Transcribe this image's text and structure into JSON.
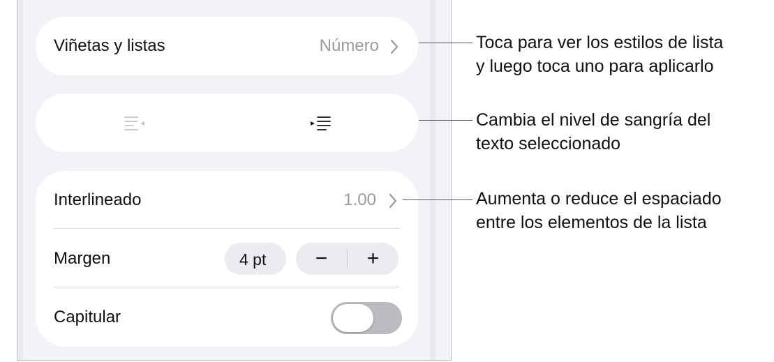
{
  "bullets_row": {
    "label": "Viñetas y listas",
    "value": "Número"
  },
  "indent_row": {
    "decrease_icon": "outdent-icon",
    "increase_icon": "indent-icon"
  },
  "spacing_row": {
    "label": "Interlineado",
    "value": "1.00"
  },
  "margin_row": {
    "label": "Margen",
    "value": "4 pt",
    "minus_label": "−",
    "plus_label": "+"
  },
  "dropcap_row": {
    "label": "Capitular",
    "toggle_on": false
  },
  "callouts": [
    {
      "lines": [
        "Toca para ver los estilos de lista",
        "y luego toca uno para aplicarlo"
      ]
    },
    {
      "lines": [
        "Cambia el nivel de sangría del",
        "texto seleccionado"
      ]
    },
    {
      "lines": [
        "Aumenta o reduce el espaciado",
        "entre los elementos de la lista"
      ]
    }
  ],
  "colors": {
    "panel_bg": "#f2f2f7",
    "card_bg": "#ffffff",
    "secondary_text": "#9a9a9f",
    "toggle_off": "#bcbcc0",
    "callout_line": "#555555"
  }
}
